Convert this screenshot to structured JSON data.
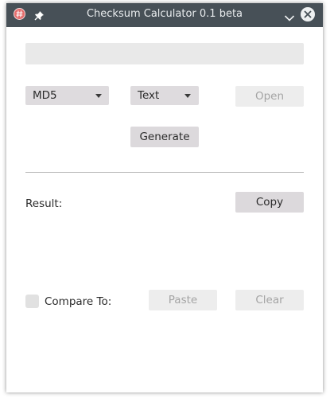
{
  "window": {
    "title": "Checksum Calculator 0.1 beta"
  },
  "input": {
    "value": ""
  },
  "algorithm": {
    "selected": "MD5"
  },
  "input_type": {
    "selected": "Text"
  },
  "buttons": {
    "open": "Open",
    "generate": "Generate",
    "copy": "Copy",
    "paste": "Paste",
    "clear": "Clear"
  },
  "result": {
    "label": "Result:",
    "value": ""
  },
  "compare": {
    "label": "Compare To:",
    "checked": false
  },
  "icons": [
    "app-icon",
    "pin-icon",
    "chevron-down-icon",
    "close-icon"
  ],
  "colors": {
    "titlebar": "#475057",
    "button": "#dcd9dc",
    "button_disabled": "#ededed",
    "close_button": "#eef0f1",
    "app_icon": "#e46d6d"
  }
}
